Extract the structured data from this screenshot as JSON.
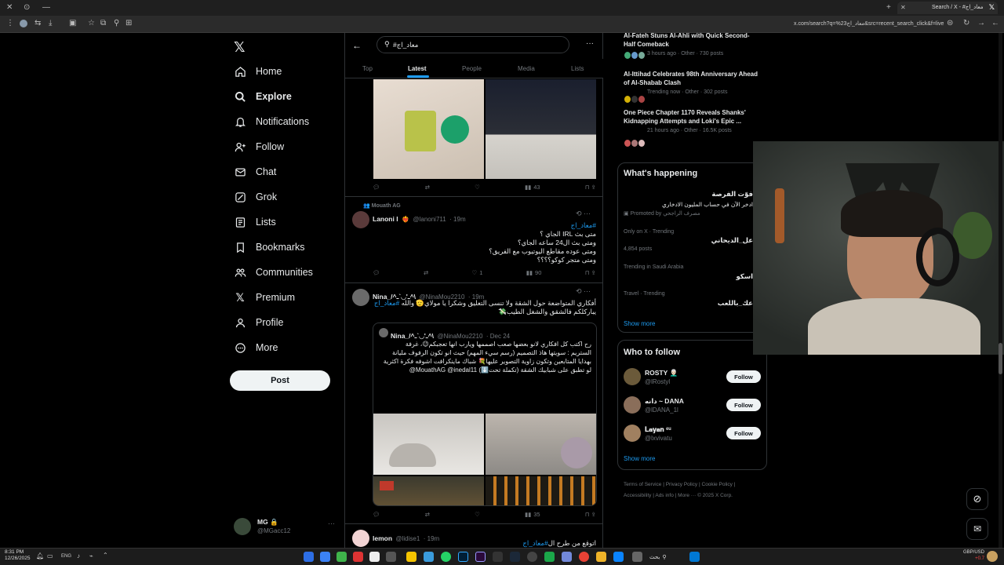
{
  "browser": {
    "tab_title": "Search / X - #معاد_اج",
    "url": "x.com/search?q=%23معاد_اج&src=recent_search_click&f=live"
  },
  "nav": {
    "items": [
      {
        "label": "Home",
        "icon": "home-icon"
      },
      {
        "label": "Explore",
        "icon": "search-icon"
      },
      {
        "label": "Notifications",
        "icon": "bell-icon"
      },
      {
        "label": "Follow",
        "icon": "follow-icon"
      },
      {
        "label": "Chat",
        "icon": "mail-icon"
      },
      {
        "label": "Grok",
        "icon": "grok-icon"
      },
      {
        "label": "Lists",
        "icon": "lists-icon"
      },
      {
        "label": "Bookmarks",
        "icon": "bookmark-icon"
      },
      {
        "label": "Communities",
        "icon": "communities-icon"
      },
      {
        "label": "Premium",
        "icon": "x-logo-icon"
      },
      {
        "label": "Profile",
        "icon": "person-icon"
      },
      {
        "label": "More",
        "icon": "more-icon"
      }
    ],
    "post_label": "Post",
    "account": {
      "name": "MG 🔒",
      "handle": "@MGacc12"
    }
  },
  "search": {
    "query": "#معاد_اج",
    "tabs": [
      "Top",
      "Latest",
      "People",
      "Media",
      "Lists"
    ],
    "active_tab": "Latest"
  },
  "tweets": [
    {
      "actions": {
        "views": "43"
      }
    },
    {
      "social_context": "Mouath AG",
      "name": "Lanoni l",
      "handle": "@lanoni711",
      "time": "19m",
      "hashtag": "#معاد_اج",
      "lines": [
        "متى بث IRL الجاي ؟",
        "ومتى بث ال24 ساعه الجاي؟",
        "ومتى عوده مقاطع اليوتيوب مع الفريق؟",
        "ومتى متجر كوكو؟؟؟؟"
      ],
      "actions": {
        "likes": "1",
        "views": "90"
      }
    },
    {
      "name": "Nina_/^ـ'◡`ـ^\\",
      "handle": "@NinaMou2210",
      "time": "19m",
      "hashtag": "#معاد_اج",
      "lines": [
        "أفكاري المتواضعة حول الشقة ولا تنسى التعليق وشكرا يا مولاي🫡 والله",
        "يباركلكم فالشقق والشغل الطيب💸"
      ],
      "quote": {
        "name": "Nina_/^ـ'◡`ـ^\\",
        "handle": "@NinaMou2210",
        "date": "Dec 24",
        "lines": [
          "رح اكتب كل افكاري لانو بعضها صعب اصممها ويارب انها تعجبكم😉، غرفة",
          "الستريم : سويتها هاذ التصميم (رسم سيء المهم) حيث انو تكون الرفوف مليانة",
          "بهدايا المتابعين وتكون زاوية التصوير عليها💐 شباك ماينكرافت اشوفه فكرة اكثرية",
          "لو تطبق على شبابيك الشقة (تكملة تحت⬇️) MouathAG @inedal11@"
        ]
      },
      "actions": {
        "views": "35"
      }
    },
    {
      "name": "lemon",
      "handle": "@lidise1",
      "time": "19m",
      "line": "اتوقع من طرح ال",
      "hashtag": "#معاد_اج"
    }
  ],
  "trending_top": [
    {
      "title": "Al-Fateh Stuns Al-Ahli with Quick Second-Half Comeback",
      "meta": "3 hours ago · Other · 730 posts"
    },
    {
      "title": "Al-Ittihad Celebrates 98th Anniversary Ahead of Al-Shabab Clash",
      "meta": "Trending now · Other · 302 posts"
    },
    {
      "title": "One Piece Chapter 1170 Reveals Shanks' Kidnapping Attempts and Loki's Epic ...",
      "meta": "21 hours ago · Other · 16.5K posts"
    }
  ],
  "whats_happening": {
    "header": "What's happening",
    "promo_title": "فوّت الفرصة",
    "promo_sub": "ادخر الآن في حساب المليون الادخاري",
    "promoted_by": "Promoted by مصرف الراجحي",
    "trends": [
      {
        "context": "Only on X · Trending",
        "title": "عل_الديحاني",
        "posts": "4,854 posts"
      },
      {
        "context": "Trending in Saudi Arabia",
        "title": "اسكو"
      },
      {
        "context": "Travel · Trending",
        "title": "عك_باللعب"
      }
    ],
    "show_more": "Show more"
  },
  "who_to_follow": {
    "header": "Who to follow",
    "users": [
      {
        "name": "ROSTY 👨🏻‍🦳",
        "handle": "@lRostyl",
        "button": "Follow",
        "color": "#6b5a3a"
      },
      {
        "name": "دانه ~ DANA",
        "handle": "@lDANA_1l",
        "button": "Follow",
        "color": "#8a6e5a"
      },
      {
        "name": "𝐋𝐚𝐲𝐚𝐧 ᵉᵘ",
        "handle": "@lxvivatu",
        "button": "Follow",
        "color": "#a08060"
      }
    ],
    "show_more": "Show more"
  },
  "footer_links": [
    "Terms of Service",
    "Privacy Policy",
    "Cookie Policy",
    "Accessibility",
    "Ads info",
    "More ···",
    "© 2025 X Corp."
  ],
  "taskbar": {
    "time": "8:31 PM",
    "date": "12/26/2025",
    "lang": "ENG",
    "search": "بحث",
    "currency": "GBP/USD",
    "currency_val": "+0.7"
  },
  "colors": {
    "accent": "#1d9bf0",
    "background": "#000000",
    "border": "#2f3336"
  }
}
